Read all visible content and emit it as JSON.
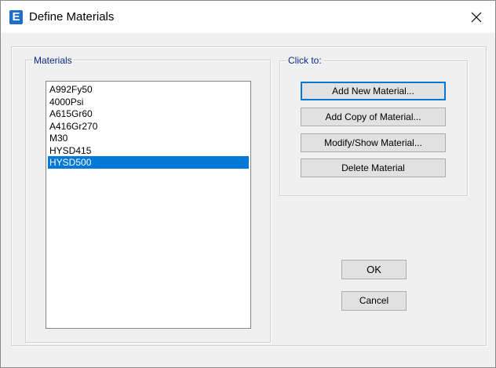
{
  "window": {
    "app_icon_letter": "E",
    "title": "Define Materials"
  },
  "materials_group": {
    "legend": "Materials",
    "items": [
      {
        "label": "A992Fy50",
        "selected": false
      },
      {
        "label": "4000Psi",
        "selected": false
      },
      {
        "label": "A615Gr60",
        "selected": false
      },
      {
        "label": "A416Gr270",
        "selected": false
      },
      {
        "label": "M30",
        "selected": false
      },
      {
        "label": "HYSD415",
        "selected": false
      },
      {
        "label": "HYSD500",
        "selected": true
      }
    ]
  },
  "click_to_group": {
    "legend": "Click to:",
    "add_new_label": "Add New Material...",
    "add_copy_label": "Add Copy of Material...",
    "modify_show_label": "Modify/Show Material...",
    "delete_label": "Delete Material"
  },
  "dialog_buttons": {
    "ok_label": "OK",
    "cancel_label": "Cancel"
  },
  "colors": {
    "selection": "#0078d7",
    "legend_text": "#0a2b8c",
    "app_icon": "#1f6fc8"
  },
  "icons": {
    "app": "etabs-app-icon",
    "close": "close-icon"
  }
}
